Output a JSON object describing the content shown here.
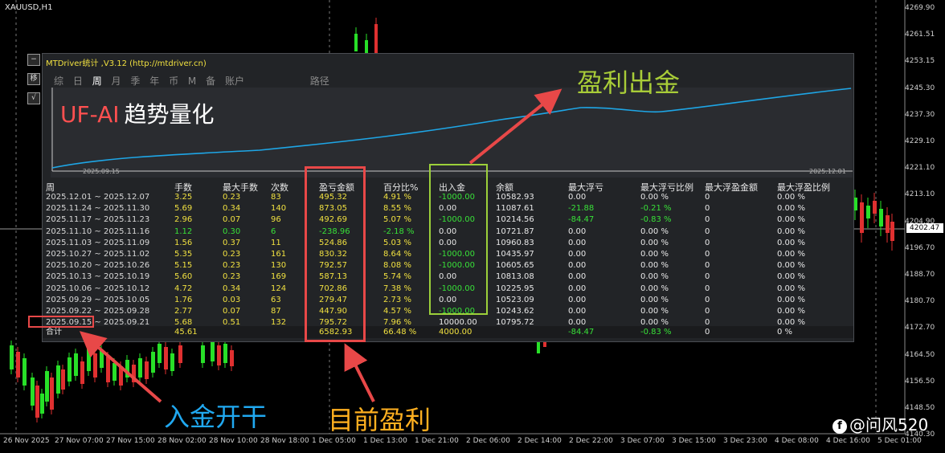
{
  "symbol": "XAUUSD,H1",
  "price_axis": [
    "4269.90",
    "4261.51",
    "4253.15",
    "4245.30",
    "4237.30",
    "4229.10",
    "4221.10",
    "4213.10",
    "4204.90",
    "4196.70",
    "4188.70",
    "4180.70",
    "4172.70",
    "4164.50",
    "4156.50",
    "4148.50",
    "4140.30"
  ],
  "current_price": "4202.47",
  "time_axis": [
    "26 Nov 2025",
    "27 Nov 07:00",
    "27 Nov 15:00",
    "28 Nov 02:00",
    "28 Nov 10:00",
    "28 Nov 18:00",
    "1 Dec 05:00",
    "1 Dec 13:00",
    "1 Dec 21:00",
    "2 Dec 06:00",
    "2 Dec 14:00",
    "2 Dec 22:00",
    "3 Dec 07:00",
    "3 Dec 15:00",
    "3 Dec 23:00",
    "4 Dec 08:00",
    "4 Dec 16:00",
    "5 Dec 01:00"
  ],
  "panel": {
    "title": "MTDriver统计 ,V3.12 (http://mtdriver.cn)",
    "tabs": [
      "综",
      "日",
      "周",
      "月",
      "季",
      "年",
      "币",
      "M",
      "备",
      "账户"
    ],
    "active_tab": "周",
    "path_label": "路径",
    "side_buttons": [
      "−",
      "移",
      "√"
    ],
    "brand_en": "UF-AI",
    "brand_cn": "趋势量化",
    "date_start": "2025.09.15",
    "date_end": "2025.12.01"
  },
  "table": {
    "headers": [
      "周",
      "手数",
      "最大手数",
      "次数",
      "盈亏金额",
      "百分比%",
      "出入金",
      "余额",
      "最大浮亏",
      "最大浮亏比例",
      "最大浮盈金额",
      "最大浮盈比例"
    ],
    "rows": [
      [
        "2025.12.01 ~ 2025.12.07",
        "3.25",
        "0.23",
        "83",
        "495.32",
        "4.91 %",
        "-1000.00",
        "10582.93",
        "0.00",
        "0.00 %",
        "0",
        "0.00 %"
      ],
      [
        "2025.11.24 ~ 2025.11.30",
        "5.69",
        "0.34",
        "140",
        "873.05",
        "8.55 %",
        "0.00",
        "11087.61",
        "-21.88",
        "-0.21 %",
        "0",
        "0.00 %"
      ],
      [
        "2025.11.17 ~ 2025.11.23",
        "2.96",
        "0.07",
        "96",
        "492.69",
        "5.07 %",
        "-1000.00",
        "10214.56",
        "-84.47",
        "-0.83 %",
        "0",
        "0.00 %"
      ],
      [
        "2025.11.10 ~ 2025.11.16",
        "1.12",
        "0.30",
        "6",
        "-238.96",
        "-2.18 %",
        "0.00",
        "10721.87",
        "0.00",
        "0.00 %",
        "0",
        "0.00 %"
      ],
      [
        "2025.11.03 ~ 2025.11.09",
        "1.56",
        "0.37",
        "11",
        "524.86",
        "5.03 %",
        "0.00",
        "10960.83",
        "0.00",
        "0.00 %",
        "0",
        "0.00 %"
      ],
      [
        "2025.10.27 ~ 2025.11.02",
        "5.35",
        "0.23",
        "161",
        "830.32",
        "8.64 %",
        "-1000.00",
        "10435.97",
        "0.00",
        "0.00 %",
        "0",
        "0.00 %"
      ],
      [
        "2025.10.20 ~ 2025.10.26",
        "5.15",
        "0.23",
        "130",
        "792.57",
        "8.08 %",
        "-1000.00",
        "10605.65",
        "0.00",
        "0.00 %",
        "0",
        "0.00 %"
      ],
      [
        "2025.10.13 ~ 2025.10.19",
        "5.60",
        "0.23",
        "169",
        "587.13",
        "5.74 %",
        "0.00",
        "10813.08",
        "0.00",
        "0.00 %",
        "0",
        "0.00 %"
      ],
      [
        "2025.10.06 ~ 2025.10.12",
        "4.72",
        "0.34",
        "124",
        "702.86",
        "7.38 %",
        "-1000.00",
        "10225.95",
        "0.00",
        "0.00 %",
        "0",
        "0.00 %"
      ],
      [
        "2025.09.29 ~ 2025.10.05",
        "1.76",
        "0.03",
        "63",
        "279.47",
        "2.73 %",
        "0.00",
        "10523.09",
        "0.00",
        "0.00 %",
        "0",
        "0.00 %"
      ],
      [
        "2025.09.22 ~ 2025.09.28",
        "2.77",
        "0.07",
        "87",
        "447.90",
        "4.57 %",
        "-1000.00",
        "10243.62",
        "0.00",
        "0.00 %",
        "0",
        "0.00 %"
      ],
      [
        "2025.09.15 ~ 2025.09.21",
        "5.68",
        "0.51",
        "132",
        "795.72",
        "7.96 %",
        "10000.00",
        "10795.72",
        "0.00",
        "0.00 %",
        "0",
        "0.00 %"
      ]
    ],
    "total": {
      "label": "合计",
      "lots": "45.61",
      "pnl": "6582.93",
      "pct": "66.48 %",
      "deposit": "4000.00",
      "max_float_loss": "-84.47",
      "max_float_loss_pct": "-0.83 %",
      "max_float_profit": "0",
      "max_float_profit_pct": "0 %"
    }
  },
  "annotations": {
    "profit_withdraw": "盈利出金",
    "deposit_start": "入金开干",
    "current_profit": "目前盈利"
  },
  "watermark": "@问风520",
  "colors": {
    "red": "#e84848",
    "green_box": "#9cd03a",
    "orange": "#ffb020",
    "blue": "#20a8f0",
    "olive": "#a8cc38",
    "equity_line": "#1ea6e6",
    "bull": "#28e028",
    "bear": "#e03030"
  }
}
